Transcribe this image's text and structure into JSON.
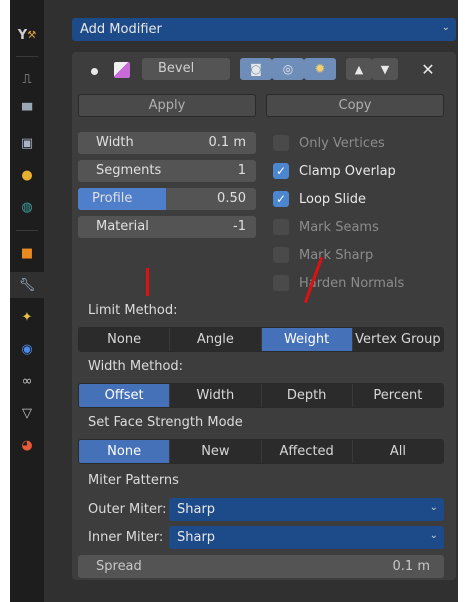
{
  "sidebar": {
    "icons": [
      "tool-icon",
      "scene-icon",
      "render-icon",
      "output-icon",
      "view-layer-icon",
      "world-icon",
      "object-icon",
      "modifier-icon",
      "particles-icon",
      "physics-icon",
      "constraints-icon",
      "object-data-icon",
      "material-icon"
    ],
    "active_icon": "modifier-icon"
  },
  "add_modifier": {
    "label": "Add Modifier"
  },
  "modifier": {
    "name": "Bevel",
    "apply_label": "Apply",
    "copy_label": "Copy"
  },
  "fields": {
    "width": {
      "label": "Width",
      "value": "0.1 m"
    },
    "segments": {
      "label": "Segments",
      "value": "1"
    },
    "profile": {
      "label": "Profile",
      "value": "0.50"
    },
    "material": {
      "label": "Material",
      "value": "-1"
    }
  },
  "checkboxes": {
    "only_vertices": {
      "label": "Only Vertices",
      "checked": false
    },
    "clamp_overlap": {
      "label": "Clamp Overlap",
      "checked": true
    },
    "loop_slide": {
      "label": "Loop Slide",
      "checked": true
    },
    "mark_seams": {
      "label": "Mark Seams",
      "checked": false
    },
    "mark_sharp": {
      "label": "Mark Sharp",
      "checked": false
    },
    "harden_normals": {
      "label": "Harden Normals",
      "checked": false
    }
  },
  "limit_method": {
    "label": "Limit Method:",
    "options": [
      "None",
      "Angle",
      "Weight",
      "Vertex Group"
    ],
    "selected": "Weight"
  },
  "width_method": {
    "label": "Width Method:",
    "options": [
      "Offset",
      "Width",
      "Depth",
      "Percent"
    ],
    "selected": "Offset"
  },
  "face_strength": {
    "label": "Set Face Strength Mode",
    "options": [
      "None",
      "New",
      "Affected",
      "All"
    ],
    "selected": "None"
  },
  "miter": {
    "title": "Miter Patterns",
    "outer_label": "Outer Miter:",
    "outer_value": "Sharp",
    "inner_label": "Inner Miter:",
    "inner_value": "Sharp",
    "spread_label": "Spread",
    "spread_value": "0.1 m"
  },
  "colors": {
    "accent": "#4471b8",
    "annotation": "#e01010"
  }
}
